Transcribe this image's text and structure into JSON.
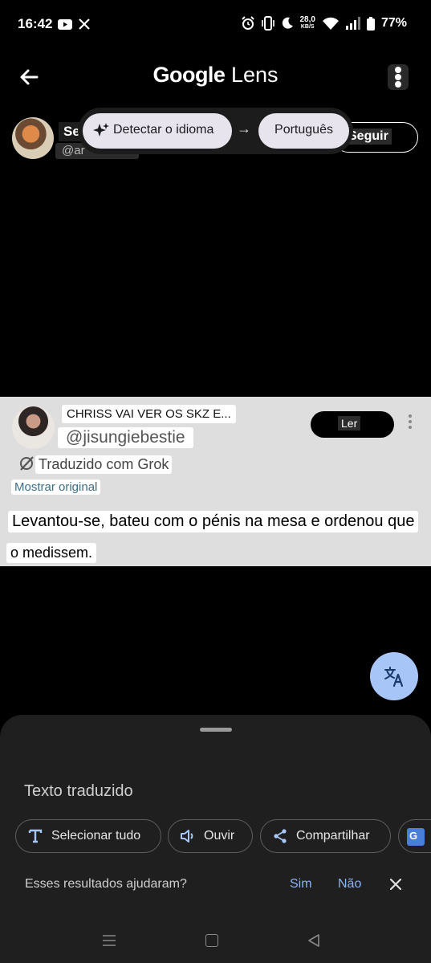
{
  "status_bar": {
    "time": "16:42",
    "net_speed_value": "28,0",
    "net_speed_unit": "KB/S",
    "battery": "77%"
  },
  "header": {
    "title_brand": "Google",
    "title_product": "Lens"
  },
  "background_tweet": {
    "name_partial": "Se",
    "handle_partial": "@ar",
    "follow_label": "Seguir"
  },
  "language_bar": {
    "source_label": "Detectar o idioma",
    "arrow": "→",
    "target_label": "Português"
  },
  "translated_card": {
    "display_name": "CHRISS VAI VER OS SKZ E...",
    "handle": "@jisungiebestie",
    "grok_note": "Traduzido com Grok",
    "show_original": "Mostrar original",
    "read_button": "Ler",
    "text_line1": "Levantou-se, bateu com o pénis na mesa e ordenou que",
    "text_line2": "o medissem."
  },
  "sheet": {
    "title": "Texto traduzido",
    "chips": {
      "select_all": "Selecionar tudo",
      "listen": "Ouvir",
      "share": "Compartilhar"
    },
    "feedback_question": "Esses resultados ajudaram?",
    "feedback_yes": "Sim",
    "feedback_no": "Não"
  },
  "colors": {
    "accent_blue": "#8ab4f8",
    "fab_background": "#a7c6f7",
    "sheet_background": "#1f1f1f"
  }
}
